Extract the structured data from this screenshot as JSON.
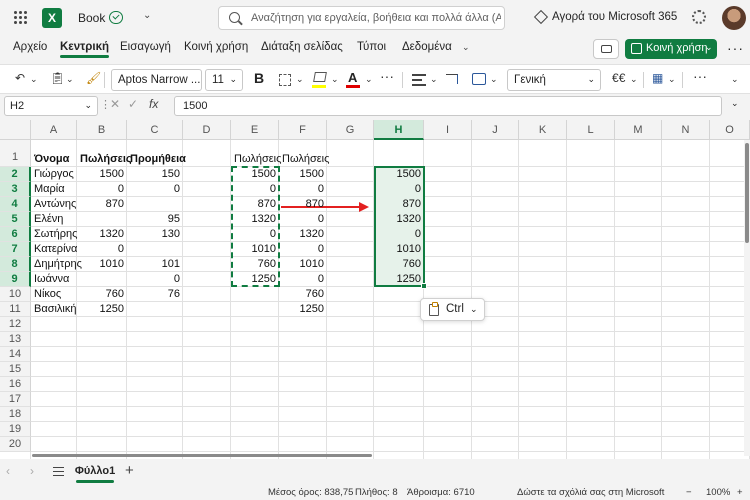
{
  "app": {
    "book_name": "Book"
  },
  "search": {
    "placeholder": "Αναζήτηση για εργαλεία, βοήθεια και πολλά άλλα (Alt"
  },
  "header": {
    "buy_label": "Αγορά του Microsoft 365"
  },
  "ribbon": {
    "tabs": [
      "Αρχείο",
      "Κεντρική",
      "Εισαγωγή",
      "Κοινή χρήση",
      "Διάταξη σελίδας",
      "Τύποι",
      "Δεδομένα"
    ],
    "share_label": "Κοινή χρήση",
    "font_name": "Aptos Narrow ...",
    "font_size": "11",
    "number_format": "Γενική",
    "currency_symbol": "€"
  },
  "formula_bar": {
    "name_box": "H2",
    "fx_label": "fx",
    "value": "1500"
  },
  "grid": {
    "columns": [
      "A",
      "B",
      "C",
      "D",
      "E",
      "F",
      "G",
      "H",
      "I",
      "J",
      "K",
      "L",
      "M",
      "N",
      "O"
    ],
    "rows": [
      "1",
      "2",
      "3",
      "4",
      "5",
      "6",
      "7",
      "8",
      "9",
      "10",
      "11",
      "12",
      "13",
      "14",
      "15",
      "16",
      "17",
      "18",
      "19",
      "20"
    ],
    "selected_column": "H",
    "headers": {
      "A": "Όνομα",
      "B": "Πωλήσεις",
      "C": "Προμήθεια",
      "E": "Πωλήσεις",
      "F": "Πωλήσεις"
    },
    "colA": [
      "Γιώργος",
      "Μαρία",
      "Αντώνης",
      "Ελένη",
      "Σωτήρης",
      "Κατερίνα",
      "Δημήτρης",
      "Ιωάννα",
      "Νίκος",
      "Βασιλική"
    ],
    "colB": [
      "1500",
      "0",
      "870",
      "",
      "1320",
      "0",
      "1010",
      "",
      "760",
      "1250"
    ],
    "colC": [
      "150",
      "0",
      "",
      "95",
      "130",
      "",
      "101",
      "0",
      "76",
      ""
    ],
    "colE": [
      "1500",
      "0",
      "870",
      "1320",
      "0",
      "1010",
      "760",
      "1250"
    ],
    "colF": [
      "1500",
      "0",
      "870",
      "0",
      "1320",
      "0",
      "1010",
      "0",
      "760",
      "1250"
    ],
    "colH": [
      "1500",
      "0",
      "870",
      "1320",
      "0",
      "1010",
      "760",
      "1250"
    ]
  },
  "paste_popup": {
    "label": "Ctrl"
  },
  "sheets": {
    "active": "Φύλλο1"
  },
  "status": {
    "average": "Μέσος όρος: 838,75",
    "count": "Πλήθος: 8",
    "sum": "Άθροισμα: 6710",
    "feedback": "Δώστε τα σχόλιά σας στη Microsoft",
    "zoom": "100%"
  },
  "colors": {
    "accent": "#107c41",
    "arrow": "#e32020"
  }
}
